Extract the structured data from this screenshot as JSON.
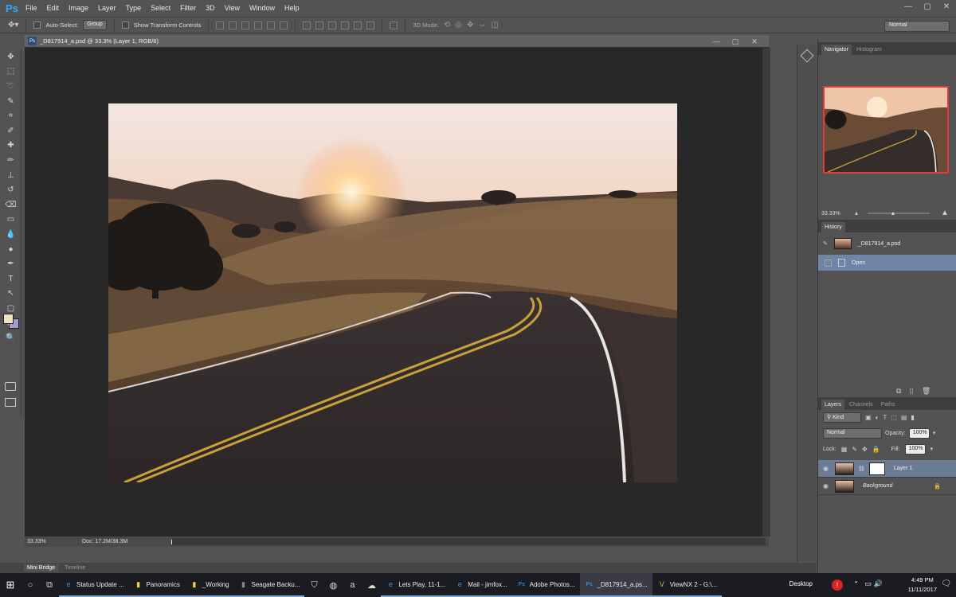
{
  "app": {
    "logo": "Ps"
  },
  "menu": [
    "File",
    "Edit",
    "Image",
    "Layer",
    "Type",
    "Select",
    "Filter",
    "3D",
    "View",
    "Window",
    "Help"
  ],
  "window_controls": [
    "—",
    "▢",
    "✕"
  ],
  "options": {
    "auto_select_label": "Auto-Select:",
    "auto_select_value": "Group",
    "transform_label": "Show Transform Controls",
    "mode_3d_label": "3D Mode:",
    "workspace_value": "Normal"
  },
  "tools": [
    "move-icon",
    "marquee-icon",
    "lasso-icon",
    "quick-select-icon",
    "crop-icon",
    "eyedropper-icon",
    "healing-icon",
    "brush-icon",
    "stamp-icon",
    "history-brush-icon",
    "eraser-icon",
    "gradient-icon",
    "blur-icon",
    "dodge-icon",
    "pen-icon",
    "type-icon",
    "path-select-icon",
    "shape-icon",
    "hand-icon",
    "zoom-icon"
  ],
  "tool_glyphs": [
    "✥",
    "⬚",
    "➰",
    "✎",
    "⌗",
    "✐",
    "✚",
    "✏",
    "⊥",
    "↺",
    "⌫",
    "▭",
    "💧",
    "●",
    "✒",
    "T",
    "↖",
    "▢",
    "✋",
    "🔍"
  ],
  "document": {
    "title": "_D817914_a.psd @ 33.3% (Layer 1, RGB/8)",
    "status_zoom": "33.33%",
    "status_doc": "Doc: 17.2M/38.3M"
  },
  "bottom_tabs": [
    "Mini Bridge",
    "Timeline"
  ],
  "navigator": {
    "tabs": [
      "Navigator",
      "Histogram"
    ],
    "zoom": "33.33%"
  },
  "history": {
    "title": "History",
    "snapshot": "_D817914_a.psd",
    "steps": [
      "Open"
    ]
  },
  "layers": {
    "tabs": [
      "Layers",
      "Channels",
      "Paths"
    ],
    "filter_kind": "Kind",
    "blend_mode": "Normal",
    "opacity_label": "Opacity:",
    "opacity_value": "100%",
    "lock_label": "Lock:",
    "fill_label": "Fill:",
    "fill_value": "100%",
    "items": [
      {
        "name": "Layer 1"
      },
      {
        "name": "Background"
      }
    ]
  },
  "taskbar": {
    "apps": [
      {
        "glyph": "e",
        "label": "Status Update ..."
      },
      {
        "glyph": "▮",
        "label": "Panoramics"
      },
      {
        "glyph": "▮",
        "label": "_Working"
      },
      {
        "glyph": "▮",
        "label": "Seagate Backu..."
      },
      {
        "glyph": "e",
        "label": "Lets Play, 11-1..."
      },
      {
        "glyph": "e",
        "label": "Mail - jimfox..."
      },
      {
        "glyph": "Ps",
        "label": "Adobe Photos..."
      },
      {
        "glyph": "Ps",
        "label": "_D817914_a.ps..."
      },
      {
        "glyph": "V",
        "label": "ViewNX 2 - G:\\..."
      }
    ],
    "desktop": "Desktop",
    "time": "4:49 PM",
    "date": "11/11/2017"
  }
}
